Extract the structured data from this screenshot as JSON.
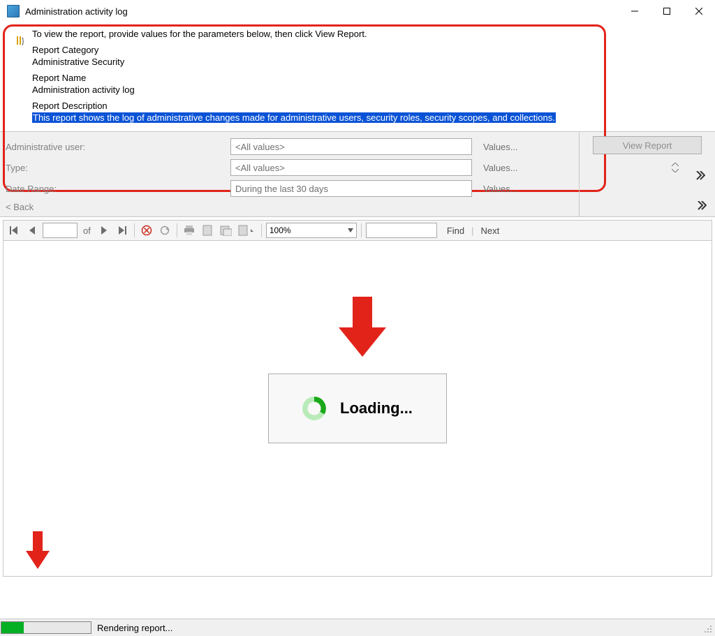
{
  "window": {
    "title": "Administration activity log"
  },
  "info": {
    "instruction": "To view the report, provide values for the parameters below, then click View Report.",
    "category_label": "Report Category",
    "category_value": "Administrative Security",
    "name_label": "Report Name",
    "name_value": "Administration activity log",
    "desc_label": "Report Description",
    "desc_value": "This report shows the log of administrative changes made for administrative users, security roles, security scopes, and collections."
  },
  "params": {
    "rows": [
      {
        "label": "Administrative user:",
        "value": "<All values>",
        "link": "Values..."
      },
      {
        "label": "Type:",
        "value": "<All values>",
        "link": "Values..."
      },
      {
        "label": "Date Range:",
        "value": "During the last 30 days",
        "link": "Values..."
      }
    ],
    "back": "< Back",
    "view_report": "View Report"
  },
  "toolbar": {
    "of": "of",
    "zoom": "100%",
    "find": "Find",
    "next": "Next"
  },
  "viewer": {
    "loading": "Loading..."
  },
  "status": {
    "text": "Rendering report..."
  }
}
